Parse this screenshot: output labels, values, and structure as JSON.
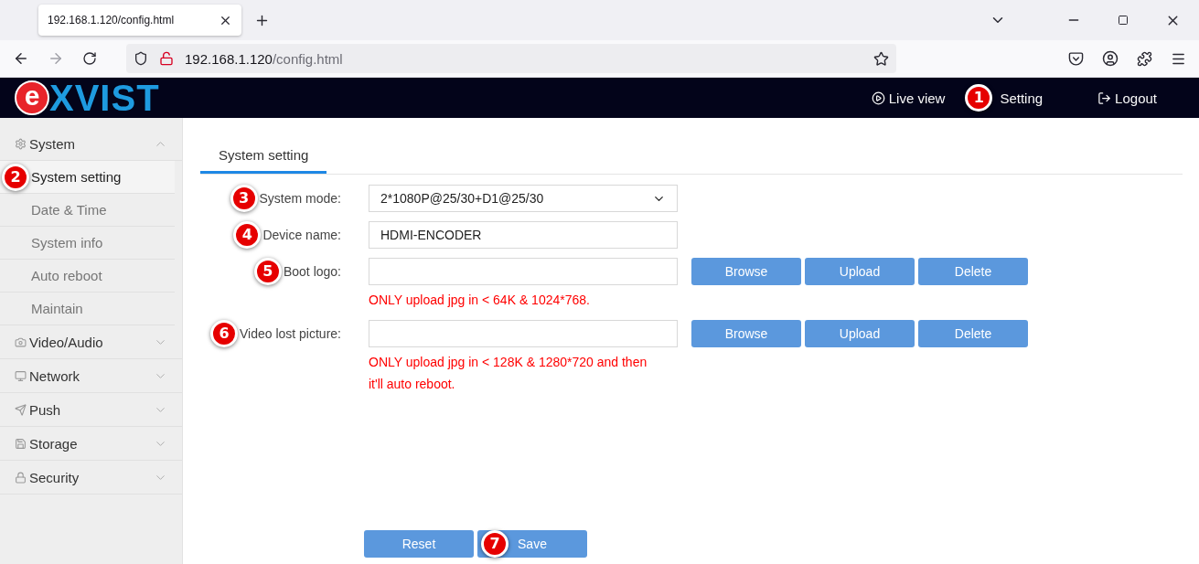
{
  "browser": {
    "tab_title": "192.168.1.120/config.html",
    "url_host": "192.168.1.120",
    "url_path": "/config.html"
  },
  "header": {
    "logo": {
      "mark": "e",
      "rest": "XVIST"
    },
    "nav": [
      {
        "kind": "play",
        "label": "Live view"
      },
      {
        "kind": "plain",
        "label": "Setting",
        "callout": "1"
      },
      {
        "kind": "logout",
        "label": "Logout"
      }
    ]
  },
  "sidebar": [
    {
      "kind": "gear",
      "label": "System",
      "expanded": true,
      "children": [
        {
          "label": "System setting",
          "selected": true,
          "callout": "2"
        },
        {
          "label": "Date & Time",
          "selected": false
        },
        {
          "label": "System info",
          "selected": false
        },
        {
          "label": "Auto reboot",
          "selected": false
        },
        {
          "label": "Maintain",
          "selected": false
        }
      ]
    },
    {
      "kind": "camera",
      "label": "Video/Audio",
      "expanded": false
    },
    {
      "kind": "monitor",
      "label": "Network",
      "expanded": false
    },
    {
      "kind": "send",
      "label": "Push",
      "expanded": false
    },
    {
      "kind": "disk",
      "label": "Storage",
      "expanded": false
    },
    {
      "kind": "lock",
      "label": "Security",
      "expanded": false
    }
  ],
  "tabs": [
    {
      "label": "System setting",
      "selected": true
    }
  ],
  "form": [
    {
      "kind": "select",
      "label": "System mode:",
      "value": "2*1080P@25/30+D1@25/30",
      "callout": "3"
    },
    {
      "kind": "text",
      "label": "Device name:",
      "value": "HDMI-ENCODER",
      "callout": "4"
    },
    {
      "kind": "file",
      "label": "Boot logo:",
      "callout": "5",
      "buttons": [
        "Browse",
        "Upload",
        "Delete"
      ],
      "hint": [
        "ONLY upload jpg in < 64K & 1024*768."
      ]
    },
    {
      "kind": "file",
      "label": "Video lost picture:",
      "callout": "6",
      "buttons": [
        "Browse",
        "Upload",
        "Delete"
      ],
      "hint": [
        "ONLY upload jpg in < 128K & 1280*720 and then",
        "it'll auto reboot."
      ]
    }
  ],
  "actions": [
    {
      "label": "Reset"
    },
    {
      "label": "Save",
      "callout": "7"
    }
  ]
}
